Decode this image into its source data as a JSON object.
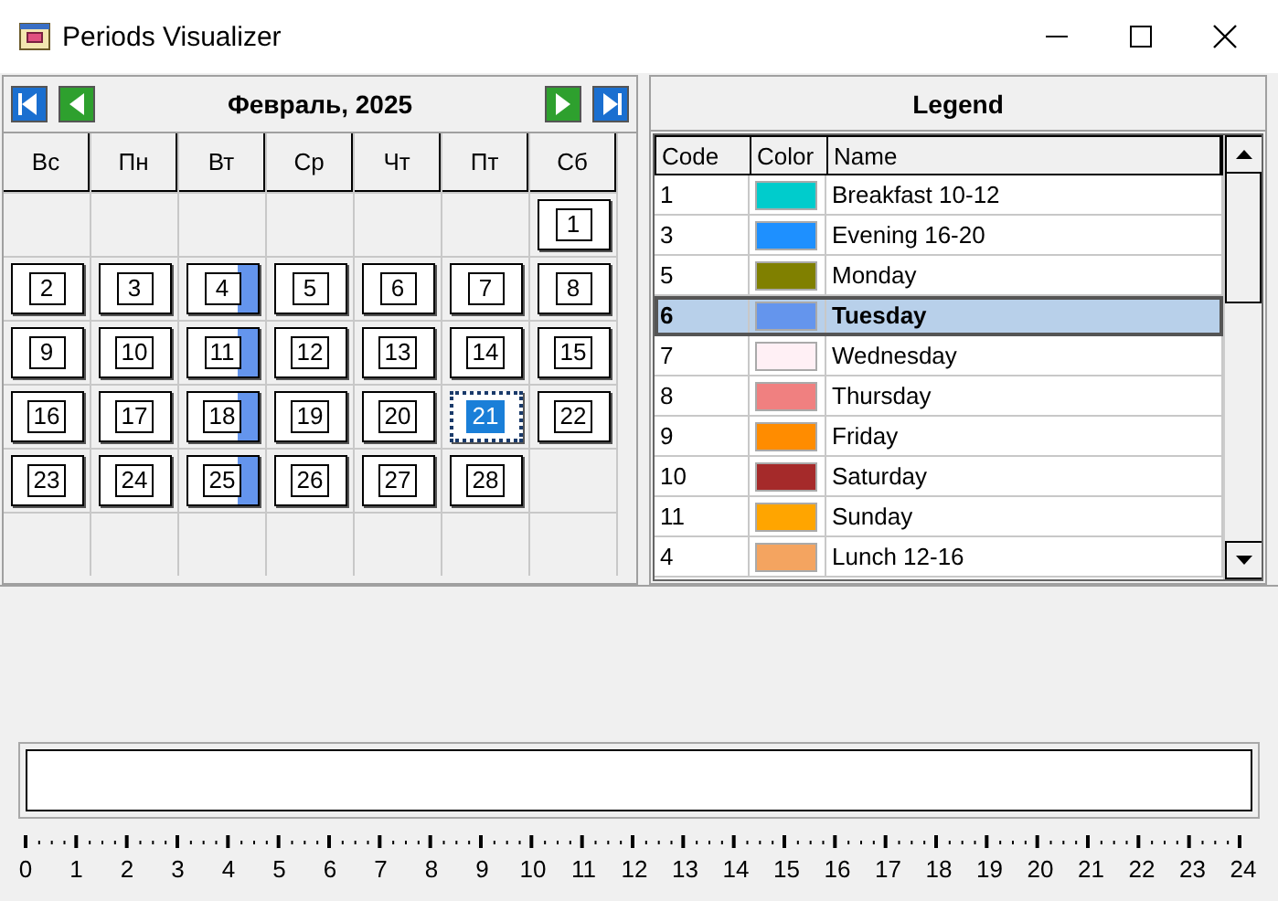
{
  "window": {
    "title": "Periods Visualizer"
  },
  "calendar": {
    "month_title": "Февраль, 2025",
    "weekdays": [
      "Вс",
      "Пн",
      "Вт",
      "Ср",
      "Чт",
      "Пт",
      "Сб"
    ],
    "weeks": [
      [
        {
          "kind": "blank"
        },
        {
          "kind": "blank"
        },
        {
          "kind": "blank"
        },
        {
          "kind": "blank"
        },
        {
          "kind": "blank"
        },
        {
          "kind": "blank"
        },
        {
          "kind": "day",
          "label": "1",
          "marked": false,
          "selected": false
        }
      ],
      [
        {
          "kind": "day",
          "label": "2",
          "marked": false,
          "selected": false
        },
        {
          "kind": "day",
          "label": "3",
          "marked": false,
          "selected": false
        },
        {
          "kind": "day",
          "label": "4",
          "marked": true,
          "selected": false
        },
        {
          "kind": "day",
          "label": "5",
          "marked": false,
          "selected": false
        },
        {
          "kind": "day",
          "label": "6",
          "marked": false,
          "selected": false
        },
        {
          "kind": "day",
          "label": "7",
          "marked": false,
          "selected": false
        },
        {
          "kind": "day",
          "label": "8",
          "marked": false,
          "selected": false
        }
      ],
      [
        {
          "kind": "day",
          "label": "9",
          "marked": false,
          "selected": false
        },
        {
          "kind": "day",
          "label": "10",
          "marked": false,
          "selected": false
        },
        {
          "kind": "day",
          "label": "11",
          "marked": true,
          "selected": false
        },
        {
          "kind": "day",
          "label": "12",
          "marked": false,
          "selected": false
        },
        {
          "kind": "day",
          "label": "13",
          "marked": false,
          "selected": false
        },
        {
          "kind": "day",
          "label": "14",
          "marked": false,
          "selected": false
        },
        {
          "kind": "day",
          "label": "15",
          "marked": false,
          "selected": false
        }
      ],
      [
        {
          "kind": "day",
          "label": "16",
          "marked": false,
          "selected": false
        },
        {
          "kind": "day",
          "label": "17",
          "marked": false,
          "selected": false
        },
        {
          "kind": "day",
          "label": "18",
          "marked": true,
          "selected": false
        },
        {
          "kind": "day",
          "label": "19",
          "marked": false,
          "selected": false
        },
        {
          "kind": "day",
          "label": "20",
          "marked": false,
          "selected": false
        },
        {
          "kind": "day",
          "label": "21",
          "marked": false,
          "selected": true
        },
        {
          "kind": "day",
          "label": "22",
          "marked": false,
          "selected": false
        }
      ],
      [
        {
          "kind": "day",
          "label": "23",
          "marked": false,
          "selected": false
        },
        {
          "kind": "day",
          "label": "24",
          "marked": false,
          "selected": false
        },
        {
          "kind": "day",
          "label": "25",
          "marked": true,
          "selected": false
        },
        {
          "kind": "day",
          "label": "26",
          "marked": false,
          "selected": false
        },
        {
          "kind": "day",
          "label": "27",
          "marked": false,
          "selected": false
        },
        {
          "kind": "day",
          "label": "28",
          "marked": false,
          "selected": false
        },
        {
          "kind": "blank"
        }
      ],
      [
        {
          "kind": "blank"
        },
        {
          "kind": "blank"
        },
        {
          "kind": "blank"
        },
        {
          "kind": "blank"
        },
        {
          "kind": "blank"
        },
        {
          "kind": "blank"
        },
        {
          "kind": "blank"
        }
      ]
    ]
  },
  "legend": {
    "title": "Legend",
    "columns": [
      "Code",
      "Color",
      "Name"
    ],
    "rows": [
      {
        "code": "1",
        "color": "#00cccc",
        "name": "Breakfast 10-12",
        "selected": false
      },
      {
        "code": "3",
        "color": "#1e90ff",
        "name": "Evening 16-20",
        "selected": false
      },
      {
        "code": "5",
        "color": "#808000",
        "name": "Monday",
        "selected": false
      },
      {
        "code": "6",
        "color": "#6495ed",
        "name": "Tuesday",
        "selected": true
      },
      {
        "code": "7",
        "color": "#fff0f5",
        "name": "Wednesday",
        "selected": false
      },
      {
        "code": "8",
        "color": "#f08080",
        "name": "Thursday",
        "selected": false
      },
      {
        "code": "9",
        "color": "#ff8c00",
        "name": "Friday",
        "selected": false
      },
      {
        "code": "10",
        "color": "#a52a2a",
        "name": "Saturday",
        "selected": false
      },
      {
        "code": "11",
        "color": "#ffa500",
        "name": "Sunday",
        "selected": false
      },
      {
        "code": "4",
        "color": "#f4a460",
        "name": "Lunch 12-16",
        "selected": false
      }
    ]
  },
  "timeline": {
    "hours": [
      "0",
      "1",
      "2",
      "3",
      "4",
      "5",
      "6",
      "7",
      "8",
      "9",
      "10",
      "11",
      "12",
      "13",
      "14",
      "15",
      "16",
      "17",
      "18",
      "19",
      "20",
      "21",
      "22",
      "23",
      "24"
    ]
  }
}
